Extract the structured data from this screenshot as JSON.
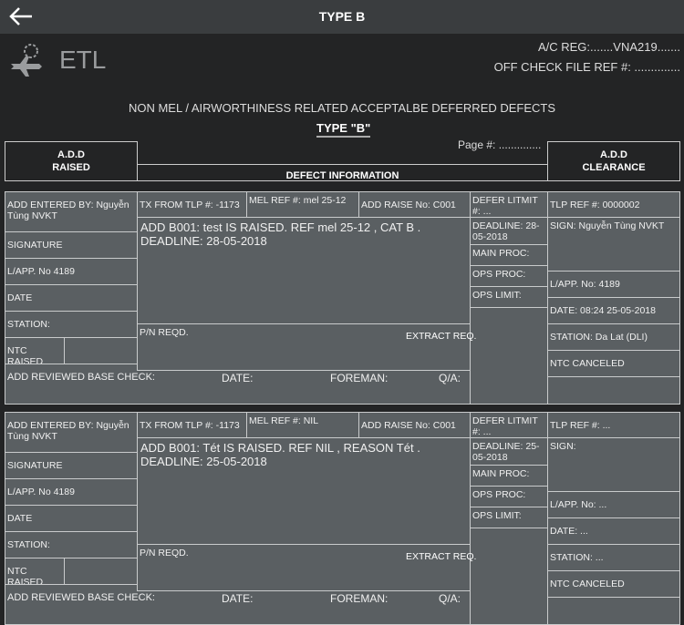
{
  "nav": {
    "title": "TYPE B"
  },
  "header": {
    "logo_text": "ETL",
    "ac_reg": "A/C REG:.......VNA219.......",
    "off_check": "OFF CHECK FILE REF #: ..............",
    "subtitle": "NON MEL / AIRWORTHINESS RELATED ACCEPTALBE DEFERRED DEFECTS",
    "type_label": "TYPE \"B\"",
    "page": "Page #: ..............",
    "col_raised": "A.D.D\nRAISED",
    "col_raised_1": "A.D.D",
    "col_raised_2": "RAISED",
    "col_defect": "DEFECT INFORMATION",
    "col_clear_1": "A.D.D",
    "col_clear_2": "CLEARANCE"
  },
  "entries": [
    {
      "entered_by": "ADD ENTERED BY: Nguyễn Tùng NVKT",
      "signature": "SIGNATURE",
      "lapp": "L/APP. No 4189",
      "date": "DATE",
      "station": "STATION:",
      "ntc_raised": "NTC RAISED",
      "tx_from": "TX FROM TLP #: -1173",
      "mel_ref": "MEL REF #: mel 25-12",
      "add_raise": "ADD RAISE No: C001",
      "description": "ADD B001: test IS RAISED. REF mel 25-12 , CAT B . DEADLINE: 28-05-2018",
      "pn_reqd": "P/N REQD.",
      "extract_req": "EXTRACT REQ.",
      "reviewed": "ADD REVIEWED BASE CHECK:",
      "rev_date": "DATE:",
      "foreman": "FOREMAN:",
      "qa": "Q/A:",
      "defer_limit": "DEFER LITMIT #: ...",
      "deadline": "DEADLINE: 28-05-2018",
      "main_proc": "MAIN PROC:",
      "ops_proc": "OPS PROC:",
      "ops_limit": "OPS LIMIT:",
      "tlp_ref": "TLP REF #: 0000002",
      "sign": "SIGN: Nguyễn Tùng NVKT",
      "clr_lapp": "L/APP. No: 4189",
      "clr_date": "DATE: 08:24 25-05-2018",
      "clr_station": "STATION: Da Lat (DLI)",
      "ntc_canceled": "NTC CANCELED"
    },
    {
      "entered_by": "ADD ENTERED BY: Nguyễn Tùng NVKT",
      "signature": "SIGNATURE",
      "lapp": "L/APP. No 4189",
      "date": "DATE",
      "station": "STATION:",
      "ntc_raised": "NTC RAISED",
      "tx_from": "TX FROM TLP #: -1173",
      "mel_ref": "MEL REF #: NIL",
      "add_raise": "ADD RAISE No: C001",
      "description": "ADD B001: Tét IS RAISED. REF NIL , REASON Tét . DEADLINE: 25-05-2018",
      "pn_reqd": "P/N REQD.",
      "extract_req": "EXTRACT REQ.",
      "reviewed": "ADD REVIEWED BASE CHECK:",
      "rev_date": "DATE:",
      "foreman": "FOREMAN:",
      "qa": "Q/A:",
      "defer_limit": "DEFER LITMIT #: ...",
      "deadline": "DEADLINE: 25-05-2018",
      "main_proc": "MAIN PROC:",
      "ops_proc": "OPS PROC:",
      "ops_limit": "OPS LIMIT:",
      "tlp_ref": "TLP REF #: ...",
      "sign": "SIGN:",
      "clr_lapp": "L/APP. No: ...",
      "clr_date": "DATE: ...",
      "clr_station": "STATION: ...",
      "ntc_canceled": "NTC CANCELED"
    }
  ]
}
